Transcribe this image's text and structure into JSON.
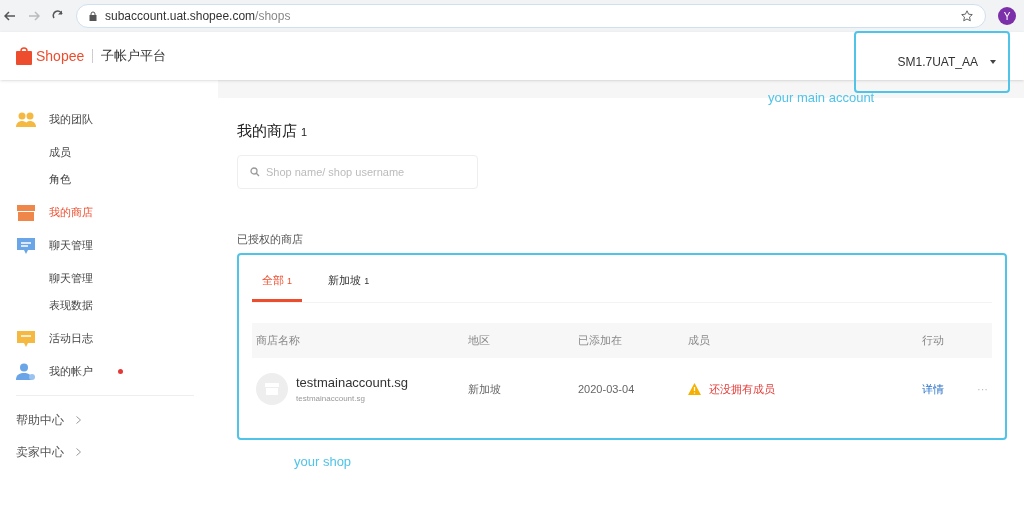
{
  "browser": {
    "url_host": "subaccount.uat.shopee.com",
    "url_path": "/shops",
    "profile": "Y"
  },
  "header": {
    "logo": "Shopee",
    "platform": "子帐户平台",
    "account": "SM1.7UAT_AA"
  },
  "annotations": {
    "account_note": "your main account",
    "shop_note": "your shop"
  },
  "sidebar": {
    "items": [
      {
        "kind": "team",
        "label": "我的团队",
        "selected": false
      },
      {
        "kind": "sub",
        "label": "成员",
        "selected": false
      },
      {
        "kind": "sub",
        "label": "角色",
        "selected": false
      },
      {
        "kind": "shop",
        "label": "我的商店",
        "selected": true
      },
      {
        "kind": "chat",
        "label": "聊天管理",
        "selected": false
      },
      {
        "kind": "sub",
        "label": "聊天管理",
        "selected": false
      },
      {
        "kind": "sub",
        "label": "表现数据",
        "selected": false
      },
      {
        "kind": "log",
        "label": "活动日志",
        "selected": false
      },
      {
        "kind": "account",
        "label": "我的帐户",
        "selected": false,
        "dot": true
      }
    ],
    "links": [
      "帮助中心",
      "卖家中心"
    ]
  },
  "main": {
    "title": "我的商店",
    "count": "1",
    "search": {
      "placeholder": "Shop name/ shop username"
    },
    "section_label": "已授权的商店",
    "tabs": [
      {
        "label": "全部",
        "count": "1",
        "selected": true
      },
      {
        "label": "新加坡",
        "count": "1",
        "selected": false
      }
    ],
    "table": {
      "columns": [
        "商店名称",
        "地区",
        "已添加在",
        "成员",
        "行动"
      ],
      "rows": [
        {
          "name": "testmainaccount.sg",
          "username": "testmainaccount.sg",
          "region": "新加坡",
          "added": "2020-03-04",
          "members": "还没拥有成员",
          "action": "详情",
          "more": "···"
        }
      ]
    }
  }
}
